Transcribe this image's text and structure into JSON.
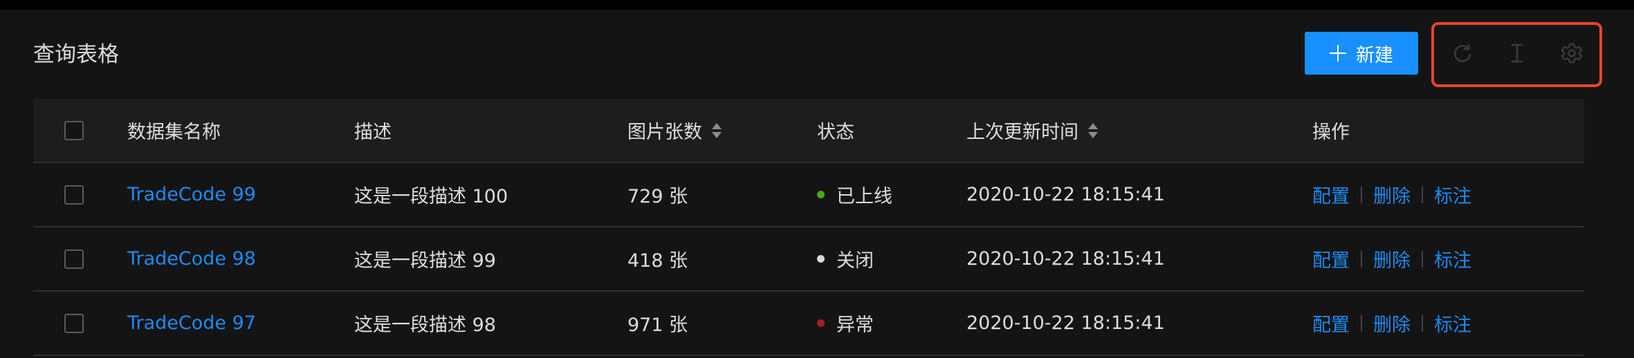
{
  "header": {
    "title": "查询表格",
    "new_button_label": "新建"
  },
  "toolbar": {
    "icons": [
      "reload-icon",
      "column-height-icon",
      "setting-icon"
    ],
    "highlight_color": "#e8452c"
  },
  "table": {
    "columns": {
      "name": "数据集名称",
      "desc": "描述",
      "count": "图片张数",
      "status": "状态",
      "updated": "上次更新时间",
      "ops": "操作"
    },
    "rows": [
      {
        "name": "TradeCode 99",
        "desc": "这是一段描述 100",
        "count": "729 张",
        "status": "已上线",
        "status_color": "#49aa19",
        "updated": "2020-10-22 18:15:41",
        "actions": [
          "配置",
          "删除",
          "标注"
        ]
      },
      {
        "name": "TradeCode 98",
        "desc": "这是一段描述 99",
        "count": "418 张",
        "status": "关闭",
        "status_color": "#d9d9d9",
        "updated": "2020-10-22 18:15:41",
        "actions": [
          "配置",
          "删除",
          "标注"
        ]
      },
      {
        "name": "TradeCode 97",
        "desc": "这是一段描述 98",
        "count": "971 张",
        "status": "异常",
        "status_color": "#a61d24",
        "updated": "2020-10-22 18:15:41",
        "actions": [
          "配置",
          "删除",
          "标注"
        ]
      }
    ]
  },
  "colors": {
    "primary": "#1890ff",
    "link": "#1d8bf0",
    "background": "#141414"
  }
}
